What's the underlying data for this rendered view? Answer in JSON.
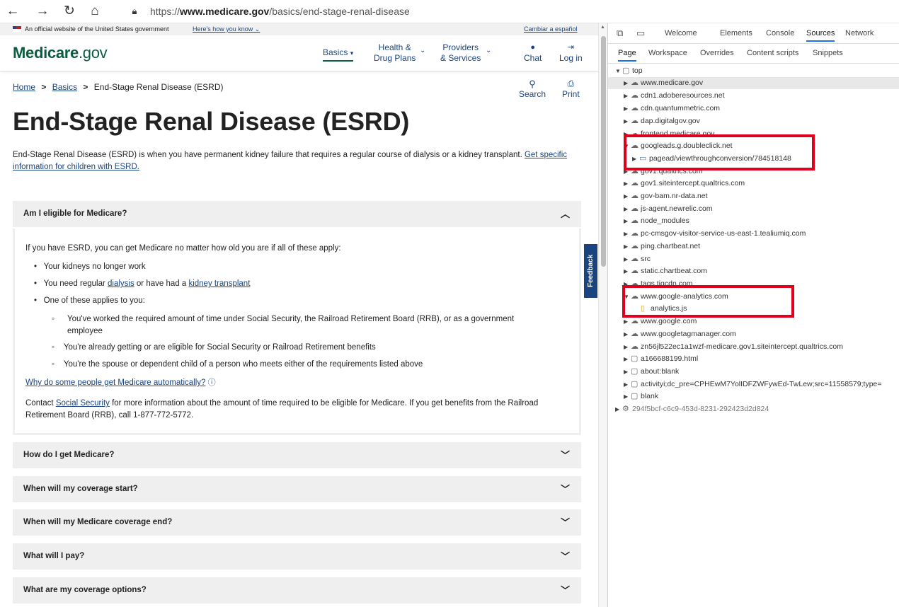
{
  "browser": {
    "url_prefix": "https://",
    "url_host": "www.medicare.gov",
    "url_path": "/basics/end-stage-renal-disease"
  },
  "govbar": {
    "text": "An official website of the United States government",
    "how": "Here's how you know",
    "spanish": "Cambiar a español"
  },
  "header": {
    "logo_main": "Medicare",
    "logo_suffix": ".gov",
    "nav_basics": "Basics",
    "nav_health_1": "Health &",
    "nav_health_2": "Drug Plans",
    "nav_providers_1": "Providers",
    "nav_providers_2": "& Services",
    "chat": "Chat",
    "login": "Log in"
  },
  "breadcrumb": {
    "home": "Home",
    "basics": "Basics",
    "current": "End-Stage Renal Disease (ESRD)",
    "sep": ">"
  },
  "tools": {
    "search": "Search",
    "print": "Print"
  },
  "page": {
    "title": "End-Stage Renal Disease (ESRD)",
    "intro": "End-Stage Renal Disease (ESRD) is when you have permanent kidney failure that requires a regular course of dialysis or a kidney transplant.",
    "intro_link": "Get specific information for children with ESRD."
  },
  "accordion": {
    "open_title": "Am I eligible for Medicare?",
    "lead": "If you have ESRD, you can get Medicare no matter how old you are if all of these apply:",
    "b1": "Your kidneys no longer work",
    "b2_pre": "You need regular ",
    "b2_link1": "dialysis",
    "b2_mid": " or have had a ",
    "b2_link2": "kidney transplant",
    "b3": "One of these applies to you:",
    "s1": "You've worked the required amount of time under Social Security, the Railroad Retirement Board (RRB), or as a government employee",
    "s2": "You're already getting or are eligible for Social Security or Railroad Retirement benefits",
    "s3": "You're the spouse or dependent child of a person who meets either of the requirements listed above",
    "why_link": "Why do some people get Medicare automatically?",
    "contact_pre": "Contact ",
    "contact_link": "Social Security",
    "contact_post": " for more information about the amount of time required to be eligible for Medicare. If you get benefits from the Railroad Retirement Board (RRB), call 1-877-772-5772.",
    "closed": [
      "How do I get Medicare?",
      "When will my coverage start?",
      "When will my Medicare coverage end?",
      "What will I pay?",
      "What are my coverage options?"
    ]
  },
  "feedback": "Feedback",
  "devtools": {
    "tabs": [
      "Welcome",
      "Elements",
      "Console",
      "Sources",
      "Network"
    ],
    "subtabs": [
      "Page",
      "Workspace",
      "Overrides",
      "Content scripts",
      "Snippets"
    ],
    "tree": [
      "top",
      "www.medicare.gov",
      "cdn1.adoberesources.net",
      "cdn.quantummetric.com",
      "dap.digitalgov.gov",
      "frontend.medicare.gov",
      "googleads.g.doubleclick.net",
      "pagead/viewthroughconversion/784518148",
      "gov1.qualtrics.com",
      "gov1.siteintercept.qualtrics.com",
      "gov-bam.nr-data.net",
      "js-agent.newrelic.com",
      "node_modules",
      "pc-cmsgov-visitor-service-us-east-1.tealiumiq.com",
      "ping.chartbeat.net",
      "src",
      "static.chartbeat.com",
      "tags.tiqcdn.com",
      "www.google-analytics.com",
      "analytics.js",
      "www.google.com",
      "www.googletagmanager.com",
      "zn56jl522ec1a1wzf-medicare.gov1.siteintercept.qualtrics.com",
      "a166688199.html",
      "about:blank",
      "activityi;dc_pre=CPHEwM7YolIDFZWFywEd-TwLew;src=11558579;type=",
      "blank",
      "294f5bcf-c6c9-453d-8231-292423d2d824"
    ]
  },
  "colors": {
    "brand": "#0b5d3f",
    "link": "#1a4480",
    "highlight": "#e0001b",
    "accordion_bg": "#efefef"
  }
}
